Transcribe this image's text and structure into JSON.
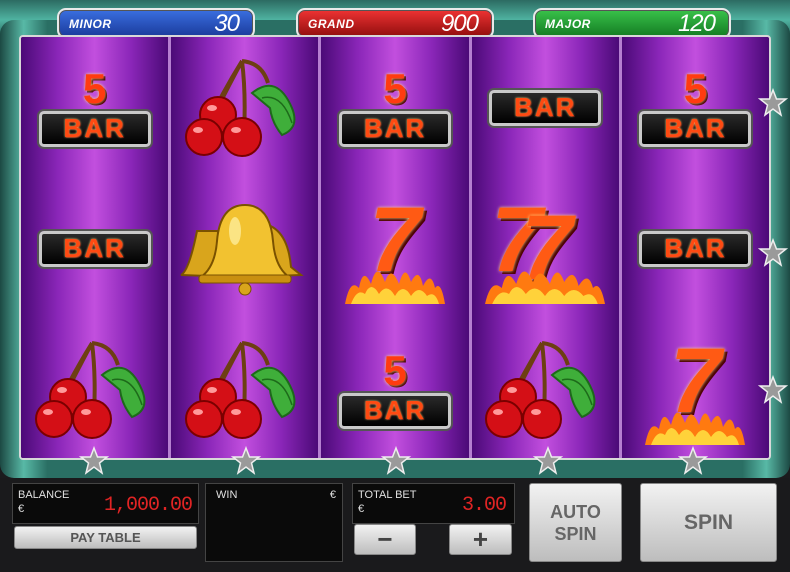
{
  "jackpots": {
    "minor": {
      "label": "MINOR",
      "value": "30"
    },
    "grand": {
      "label": "GRAND",
      "value": "900"
    },
    "major": {
      "label": "MAJOR",
      "value": "120"
    }
  },
  "reels": [
    [
      "5-bar",
      "bar",
      "cherries"
    ],
    [
      "cherries",
      "bell",
      "cherries"
    ],
    [
      "5-bar",
      "seven",
      "5-bar"
    ],
    [
      "bar",
      "double-seven",
      "cherries"
    ],
    [
      "5-bar",
      "bar",
      "seven"
    ]
  ],
  "symbols": {
    "bar_text": "BAR",
    "five_text": "5",
    "seven_text": "7"
  },
  "colors": {
    "reel_purple": "#8a26b8",
    "frame_teal": "#4fb3a1",
    "digits_red": "#e02424"
  },
  "panel": {
    "balance_label": "BALANCE",
    "balance_currency": "€",
    "balance_value": "1,000.00",
    "win_label": "WIN",
    "win_currency": "€",
    "total_bet_label": "TOTAL BET",
    "total_bet_currency": "€",
    "total_bet_value": "3.00",
    "minus_label": "−",
    "plus_label": "+",
    "pay_table_label": "PAY TABLE",
    "auto_spin_line1": "AUTO",
    "auto_spin_line2": "SPIN",
    "spin_label": "SPIN"
  }
}
